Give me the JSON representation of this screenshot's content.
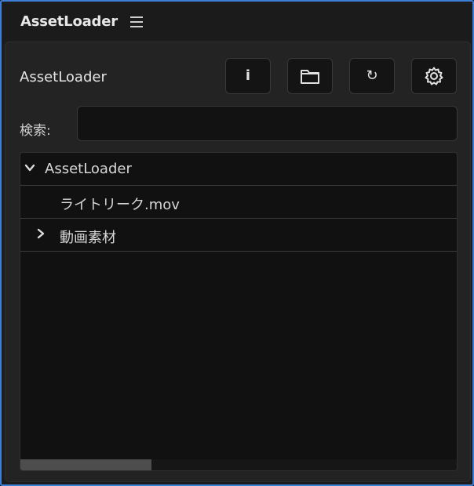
{
  "panel": {
    "tab_title": "AssetLoader",
    "menu_icon": "hamburger-menu-icon"
  },
  "header": {
    "title": "AssetLoader",
    "buttons": [
      {
        "name": "info",
        "icon": "info-icon",
        "glyph": "i"
      },
      {
        "name": "open-folder",
        "icon": "folder-icon"
      },
      {
        "name": "refresh",
        "icon": "refresh-icon",
        "glyph": "↻"
      },
      {
        "name": "settings",
        "icon": "gear-icon"
      }
    ]
  },
  "search": {
    "label": "検索:",
    "value": "",
    "placeholder": ""
  },
  "tree": {
    "items": [
      {
        "label": "AssetLoader",
        "type": "folder",
        "expanded": true,
        "depth": 0
      },
      {
        "label": "ライトリーク.mov",
        "type": "file",
        "depth": 1
      },
      {
        "label": "動画素材",
        "type": "folder",
        "expanded": false,
        "depth": 1
      }
    ],
    "scroll": {
      "horizontal_thumb_fraction": 0.3
    }
  },
  "colors": {
    "accent_border": "#3d7fd6",
    "panel_bg": "#232323",
    "tree_bg": "#111111",
    "text": "#d7d7d7"
  }
}
